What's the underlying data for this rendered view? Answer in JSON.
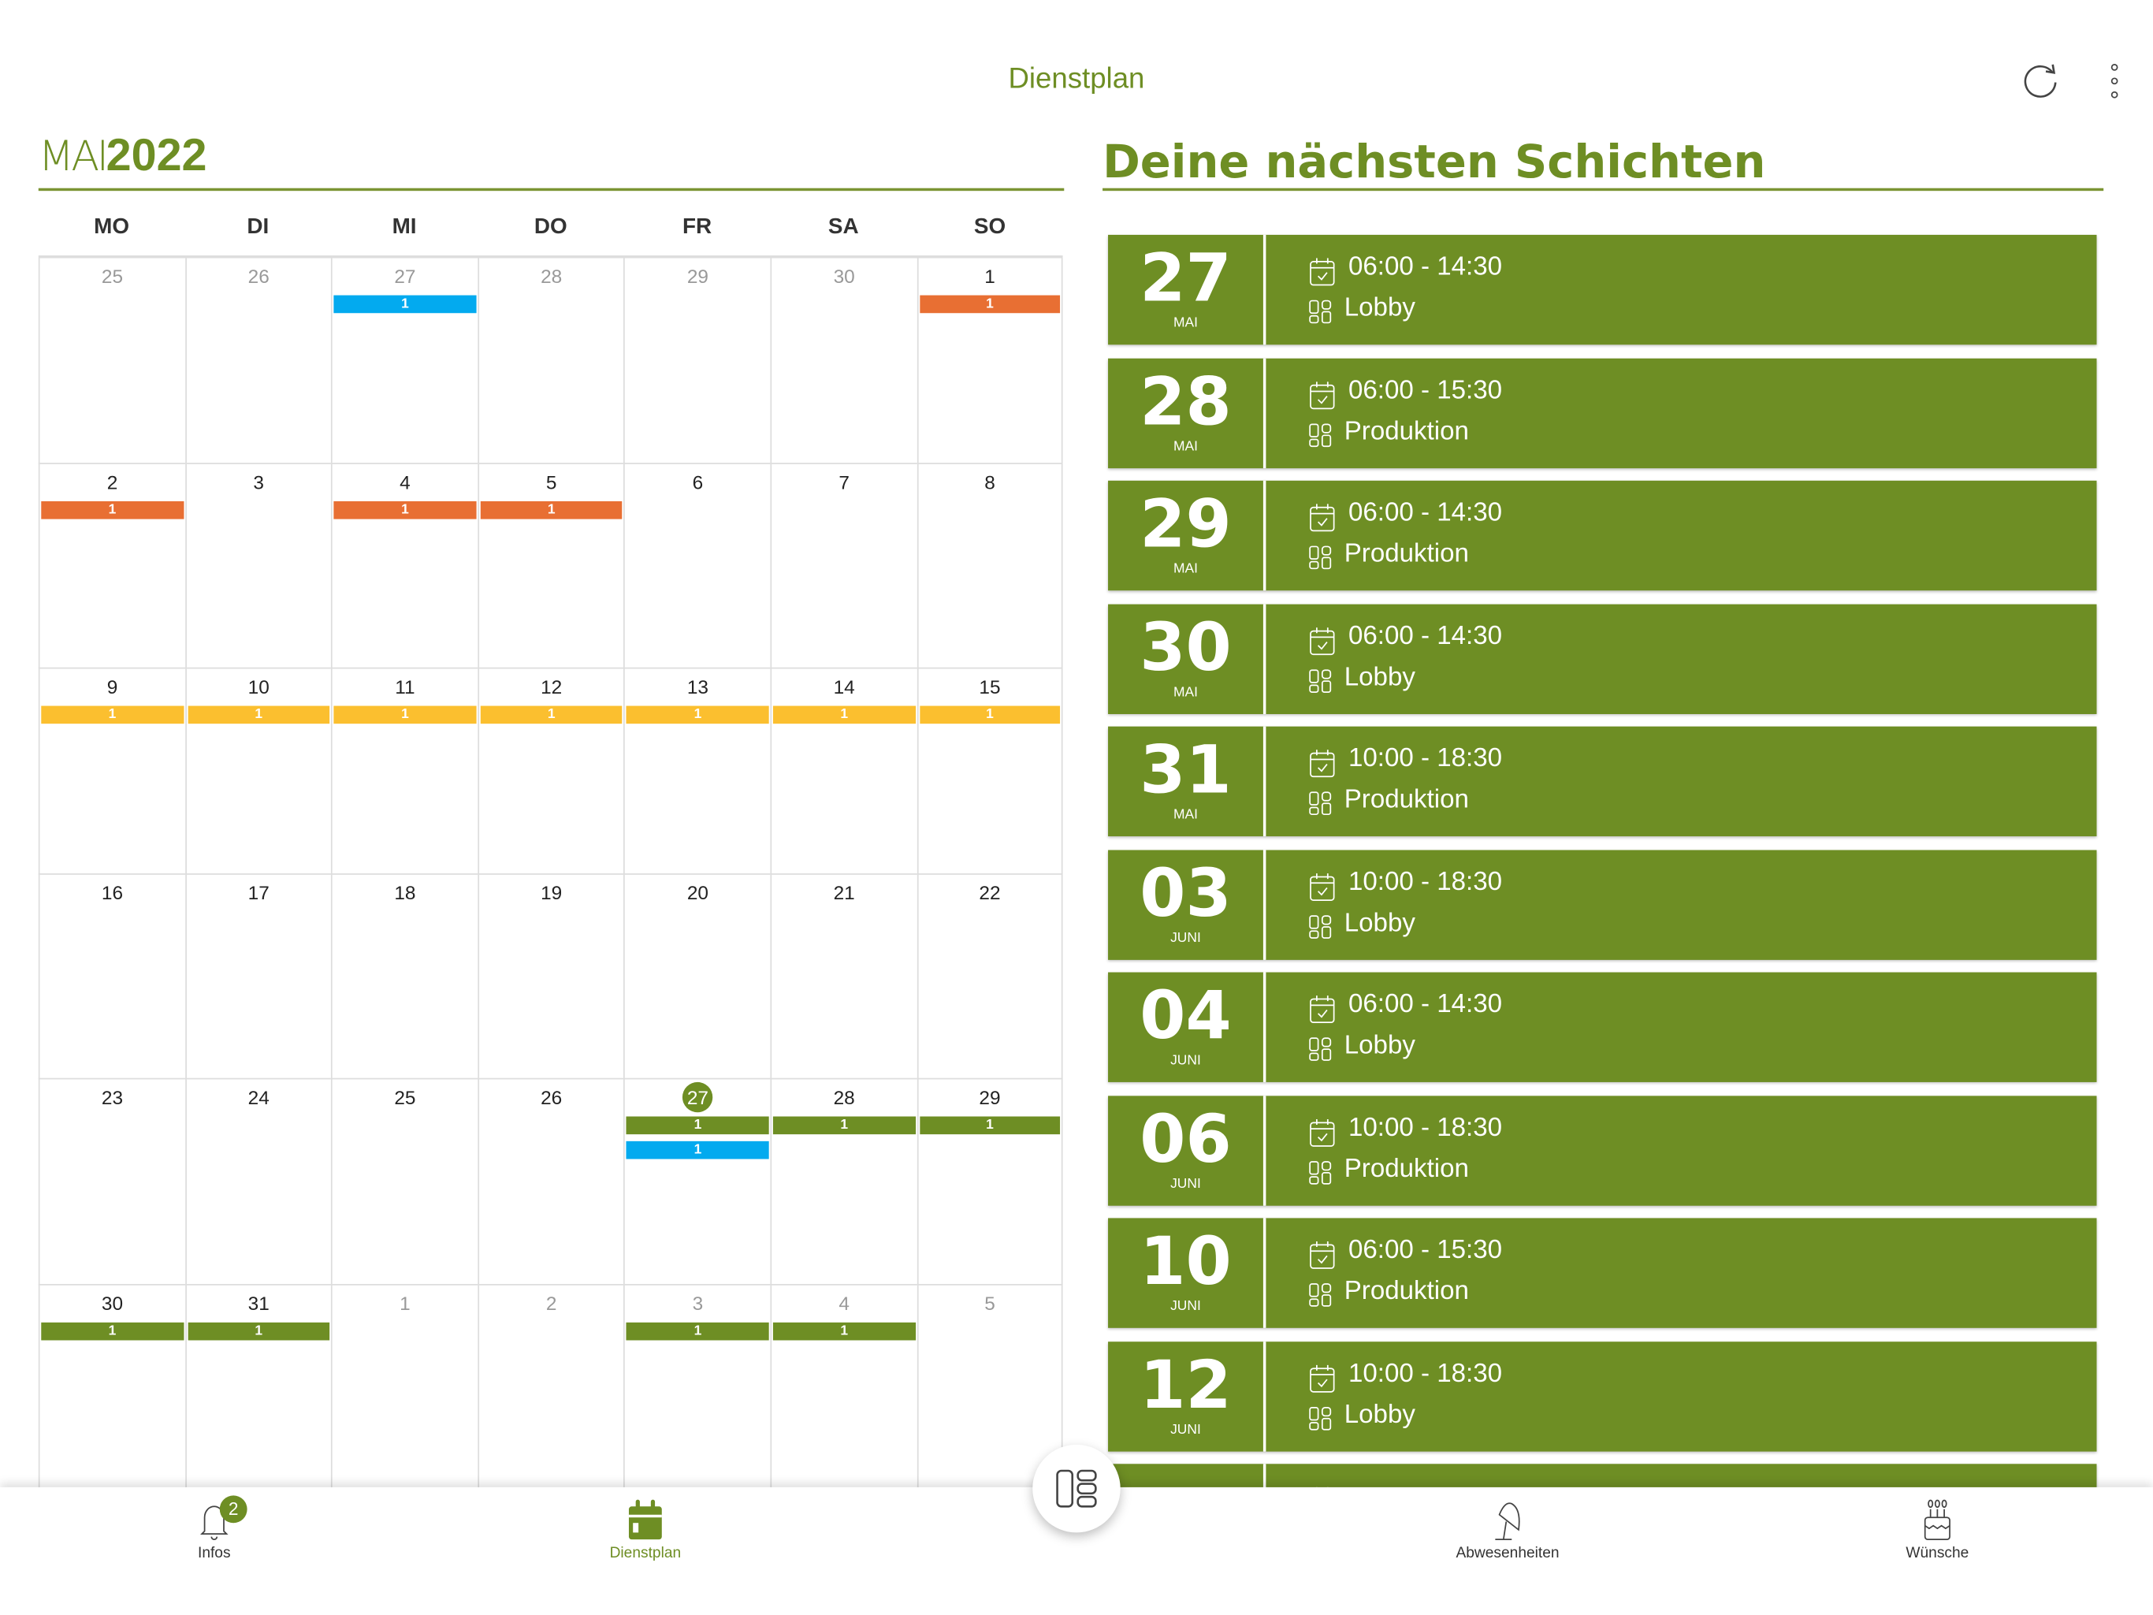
{
  "header": {
    "title": "Dienstplan",
    "refresh_icon": "refresh-icon",
    "menu_icon": "more-vertical-icon"
  },
  "calendar": {
    "month": "MAI",
    "year": "2022",
    "weekdays": [
      "MO",
      "DI",
      "MI",
      "DO",
      "FR",
      "SA",
      "SO"
    ],
    "colors": {
      "blue": "#03aaef",
      "orange": "#e86f33",
      "yellow": "#fbbf2f",
      "green": "#6e8e24"
    },
    "weeks": [
      [
        {
          "d": "25",
          "muted": true,
          "bars": []
        },
        {
          "d": "26",
          "muted": true,
          "bars": []
        },
        {
          "d": "27",
          "muted": true,
          "bars": [
            {
              "c": "blue",
              "t": "1"
            }
          ]
        },
        {
          "d": "28",
          "muted": true,
          "bars": []
        },
        {
          "d": "29",
          "muted": true,
          "bars": []
        },
        {
          "d": "30",
          "muted": true,
          "bars": []
        },
        {
          "d": "1",
          "bars": [
            {
              "c": "orange",
              "t": "1"
            }
          ]
        }
      ],
      [
        {
          "d": "2",
          "bars": [
            {
              "c": "orange",
              "t": "1"
            }
          ]
        },
        {
          "d": "3",
          "bars": []
        },
        {
          "d": "4",
          "bars": [
            {
              "c": "orange",
              "t": "1"
            }
          ]
        },
        {
          "d": "5",
          "bars": [
            {
              "c": "orange",
              "t": "1"
            }
          ]
        },
        {
          "d": "6",
          "bars": []
        },
        {
          "d": "7",
          "bars": []
        },
        {
          "d": "8",
          "bars": []
        }
      ],
      [
        {
          "d": "9",
          "bars": [
            {
              "c": "yellow",
              "t": "1"
            }
          ]
        },
        {
          "d": "10",
          "bars": [
            {
              "c": "yellow",
              "t": "1"
            }
          ]
        },
        {
          "d": "11",
          "bars": [
            {
              "c": "yellow",
              "t": "1"
            }
          ]
        },
        {
          "d": "12",
          "bars": [
            {
              "c": "yellow",
              "t": "1"
            }
          ]
        },
        {
          "d": "13",
          "bars": [
            {
              "c": "yellow",
              "t": "1"
            }
          ]
        },
        {
          "d": "14",
          "bars": [
            {
              "c": "yellow",
              "t": "1"
            }
          ]
        },
        {
          "d": "15",
          "bars": [
            {
              "c": "yellow",
              "t": "1"
            }
          ]
        }
      ],
      [
        {
          "d": "16",
          "bars": []
        },
        {
          "d": "17",
          "bars": []
        },
        {
          "d": "18",
          "bars": []
        },
        {
          "d": "19",
          "bars": []
        },
        {
          "d": "20",
          "bars": []
        },
        {
          "d": "21",
          "bars": []
        },
        {
          "d": "22",
          "bars": []
        }
      ],
      [
        {
          "d": "23",
          "bars": []
        },
        {
          "d": "24",
          "bars": []
        },
        {
          "d": "25",
          "bars": []
        },
        {
          "d": "26",
          "bars": []
        },
        {
          "d": "27",
          "today": true,
          "bars": [
            {
              "c": "green",
              "t": "1"
            },
            {
              "c": "blue",
              "t": "1"
            }
          ]
        },
        {
          "d": "28",
          "bars": [
            {
              "c": "green",
              "t": "1"
            }
          ]
        },
        {
          "d": "29",
          "bars": [
            {
              "c": "green",
              "t": "1"
            }
          ]
        }
      ],
      [
        {
          "d": "30",
          "bars": [
            {
              "c": "green",
              "t": "1"
            }
          ]
        },
        {
          "d": "31",
          "bars": [
            {
              "c": "green",
              "t": "1"
            }
          ]
        },
        {
          "d": "1",
          "muted": true,
          "bars": []
        },
        {
          "d": "2",
          "muted": true,
          "bars": []
        },
        {
          "d": "3",
          "muted": true,
          "bars": [
            {
              "c": "green",
              "t": "1"
            }
          ]
        },
        {
          "d": "4",
          "muted": true,
          "bars": [
            {
              "c": "green",
              "t": "1"
            }
          ]
        },
        {
          "d": "5",
          "muted": true,
          "bars": []
        }
      ]
    ]
  },
  "shifts": {
    "title": "Deine nächsten Schichten",
    "items": [
      {
        "day": "27",
        "month": "MAI",
        "time": "06:00 - 14:30",
        "location": "Lobby"
      },
      {
        "day": "28",
        "month": "MAI",
        "time": "06:00 - 15:30",
        "location": "Produktion"
      },
      {
        "day": "29",
        "month": "MAI",
        "time": "06:00 - 14:30",
        "location": "Produktion"
      },
      {
        "day": "30",
        "month": "MAI",
        "time": "06:00 - 14:30",
        "location": "Lobby"
      },
      {
        "day": "31",
        "month": "MAI",
        "time": "10:00 - 18:30",
        "location": "Produktion"
      },
      {
        "day": "03",
        "month": "JUNI",
        "time": "10:00 - 18:30",
        "location": "Lobby"
      },
      {
        "day": "04",
        "month": "JUNI",
        "time": "06:00 - 14:30",
        "location": "Lobby"
      },
      {
        "day": "06",
        "month": "JUNI",
        "time": "10:00 - 18:30",
        "location": "Produktion"
      },
      {
        "day": "10",
        "month": "JUNI",
        "time": "06:00 - 15:30",
        "location": "Produktion"
      },
      {
        "day": "12",
        "month": "JUNI",
        "time": "10:00 - 18:30",
        "location": "Lobby"
      },
      {
        "day": "",
        "month": "",
        "time": "",
        "location": ""
      }
    ]
  },
  "nav": {
    "infos": "Infos",
    "infos_badge": "2",
    "dienstplan": "Dienstplan",
    "abwesenheiten": "Abwesenheiten",
    "wuensche": "Wünsche"
  }
}
